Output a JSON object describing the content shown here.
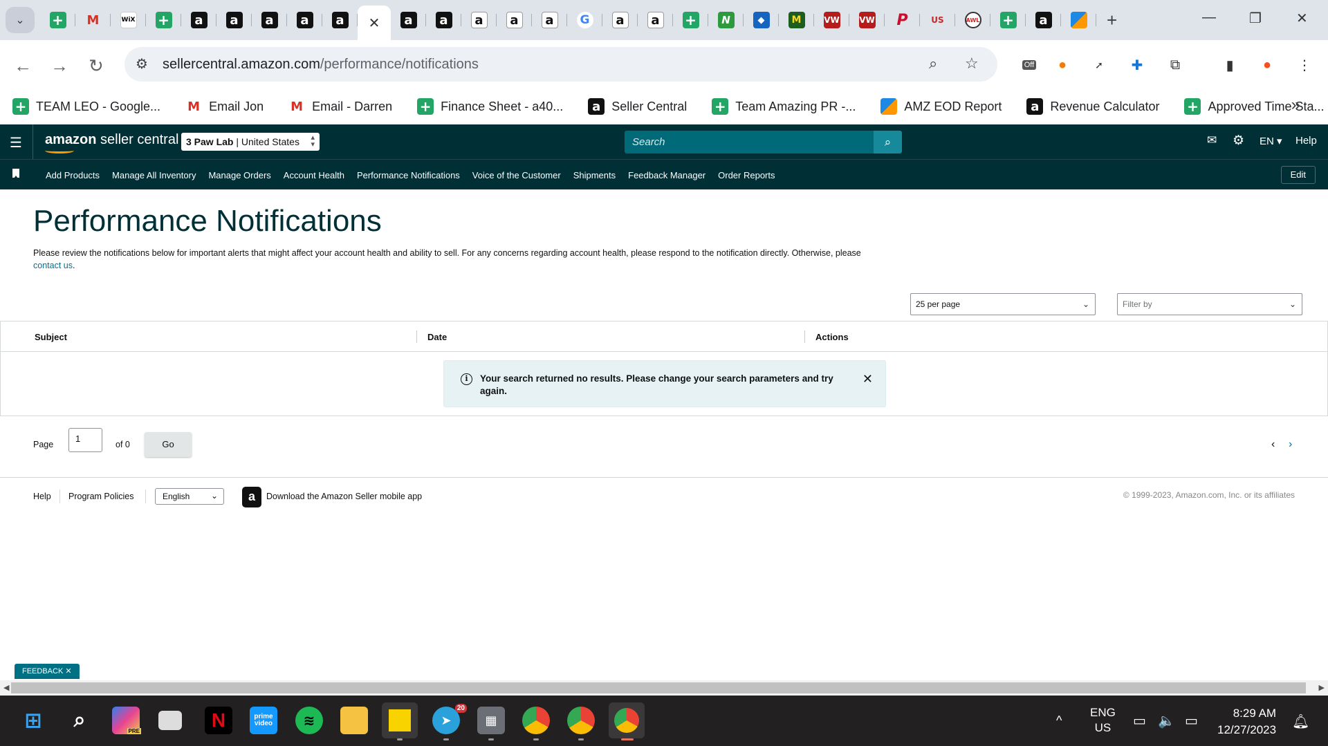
{
  "browser": {
    "active_tab_close": "✕",
    "new_tab": "+",
    "address": {
      "domain": "sellercentral.amazon.com",
      "path": "/performance/notifications"
    },
    "extension_badge": "Off",
    "bookmarks": [
      {
        "label": "TEAM LEO - Google...",
        "icon": "sheets-icon"
      },
      {
        "label": "Email Jon",
        "icon": "gmail-icon"
      },
      {
        "label": "Email - Darren",
        "icon": "gmail-icon"
      },
      {
        "label": "Finance Sheet - a40...",
        "icon": "sheets-icon"
      },
      {
        "label": "Seller Central",
        "icon": "amazon-icon"
      },
      {
        "label": "Team Amazing PR -...",
        "icon": "sheets-icon"
      },
      {
        "label": "AMZ EOD Report",
        "icon": "pencil-icon"
      },
      {
        "label": "Revenue Calculator",
        "icon": "amazon-icon"
      },
      {
        "label": "Approved Time Sta...",
        "icon": "sheets-icon"
      }
    ]
  },
  "header": {
    "logo": {
      "brand": "amazon",
      "product": "seller central"
    },
    "store": {
      "name": "3 Paw Lab",
      "region": "United States"
    },
    "search_placeholder": "Search",
    "language": "EN",
    "help": "Help"
  },
  "nav": {
    "links": [
      "Add Products",
      "Manage All Inventory",
      "Manage Orders",
      "Account Health",
      "Performance Notifications",
      "Voice of the Customer",
      "Shipments",
      "Feedback Manager",
      "Order Reports"
    ],
    "edit": "Edit"
  },
  "page": {
    "title": "Performance Notifications",
    "intro": "Please review the notifications below for important alerts that might affect your account health and ability to sell. For any concerns regarding account health, please respond to the notification directly. Otherwise, please",
    "intro_link": "contact us",
    "intro_end": ".",
    "per_page": "25 per page",
    "filter_placeholder": "Filter by",
    "columns": [
      "Subject",
      "Date",
      "Actions"
    ],
    "alert": "Your search returned no results. Please change your search parameters and try again.",
    "pager": {
      "label": "Page",
      "value": "1",
      "of": "of 0",
      "go": "Go"
    }
  },
  "footer": {
    "help": "Help",
    "policies": "Program Policies",
    "language": "English",
    "app": "Download the Amazon Seller mobile app",
    "copyright": "© 1999-2023, Amazon.com, Inc. or its affiliates",
    "feedback": "FEEDBACK ✕"
  },
  "taskbar": {
    "lang": "ENG",
    "region": "US",
    "time": "8:29 AM",
    "date": "12/27/2023",
    "telegram_badge": "20",
    "copilot_badge": "PRE"
  },
  "colors": {
    "header_bg": "#002f36",
    "search_bg": "#006a79",
    "link": "#00728f",
    "alert_bg": "#e6f2f4",
    "feedback_bg": "#007185"
  }
}
